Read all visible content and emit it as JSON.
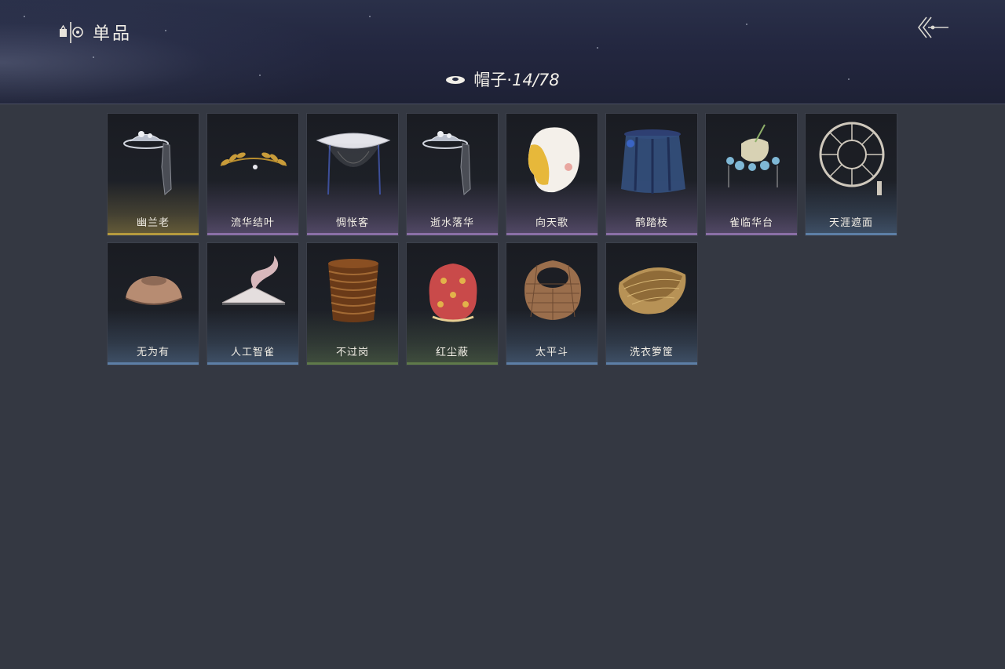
{
  "header": {
    "section_title": "单品",
    "section_icon": "wardrobe-icon",
    "back_icon": "back-arrow-icon"
  },
  "category": {
    "label": "帽子·",
    "count": "14/78",
    "icon": "hat-icon"
  },
  "colors": {
    "gold": "#b59a3e",
    "purple": "#8a6fa6",
    "blue": "#5d7fa6",
    "green": "#5f7a4a"
  },
  "items": [
    {
      "name": "幽兰老",
      "rarity": "gold"
    },
    {
      "name": "流华结叶",
      "rarity": "purple"
    },
    {
      "name": "惆怅客",
      "rarity": "purple"
    },
    {
      "name": "逝水落华",
      "rarity": "purple"
    },
    {
      "name": "向天歌",
      "rarity": "purple"
    },
    {
      "name": "鹊踏枝",
      "rarity": "purple"
    },
    {
      "name": "雀临华台",
      "rarity": "purple"
    },
    {
      "name": "天涯遮面",
      "rarity": "blue"
    },
    {
      "name": "无为有",
      "rarity": "blue"
    },
    {
      "name": "人工智雀",
      "rarity": "blue"
    },
    {
      "name": "不过岗",
      "rarity": "green"
    },
    {
      "name": "红尘蔽",
      "rarity": "green"
    },
    {
      "name": "太平斗",
      "rarity": "blue"
    },
    {
      "name": "洗衣箩筐",
      "rarity": "blue"
    }
  ]
}
